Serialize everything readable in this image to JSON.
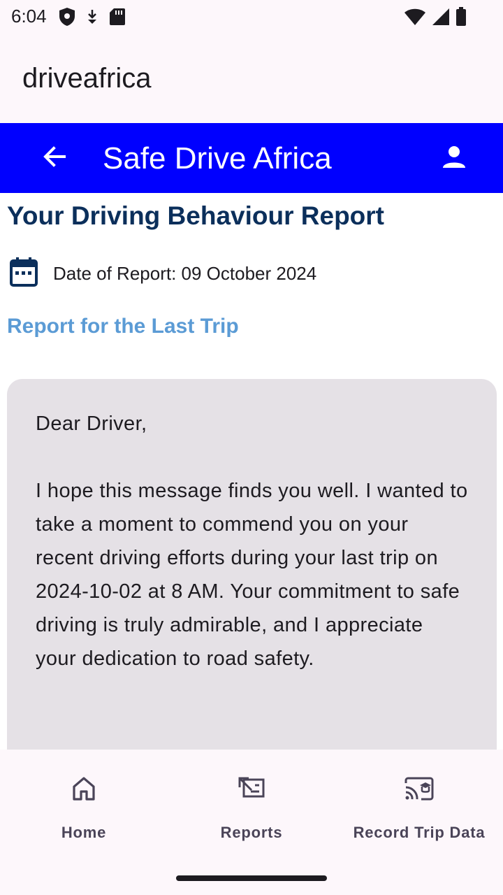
{
  "status_bar": {
    "time": "6:04",
    "left_icons": [
      "shield-icon",
      "download-icon",
      "sd-card-icon"
    ],
    "right_icons": [
      "wifi-icon",
      "signal-icon",
      "battery-icon"
    ]
  },
  "app": {
    "title": "driveafrica"
  },
  "top_bar": {
    "title": "Safe Drive Africa",
    "background": "#0000ff",
    "back_icon": "arrow-back-icon",
    "profile_icon": "person-icon"
  },
  "report": {
    "heading": "Your Driving Behaviour Report",
    "date_label": "Date of Report: 09 October 2024",
    "section_title": "Report for the Last Trip",
    "greeting": "Dear Driver,",
    "body": "I hope this message finds you well. I wanted to take a moment to commend you on your recent driving efforts during your last trip on 2024-10-02 at 8 AM. Your commitment to safe driving is truly admirable, and I appreciate your dedication to road safety."
  },
  "bottom_nav": {
    "items": [
      {
        "label": "Home",
        "icon": "home-icon"
      },
      {
        "label": "Reports",
        "icon": "reports-icon"
      },
      {
        "label": "Record Trip Data",
        "icon": "cast-for-education-icon"
      }
    ]
  },
  "colors": {
    "heading": "#0b2f5b",
    "link": "#5b9bd5",
    "card": "#e5e1e6"
  }
}
